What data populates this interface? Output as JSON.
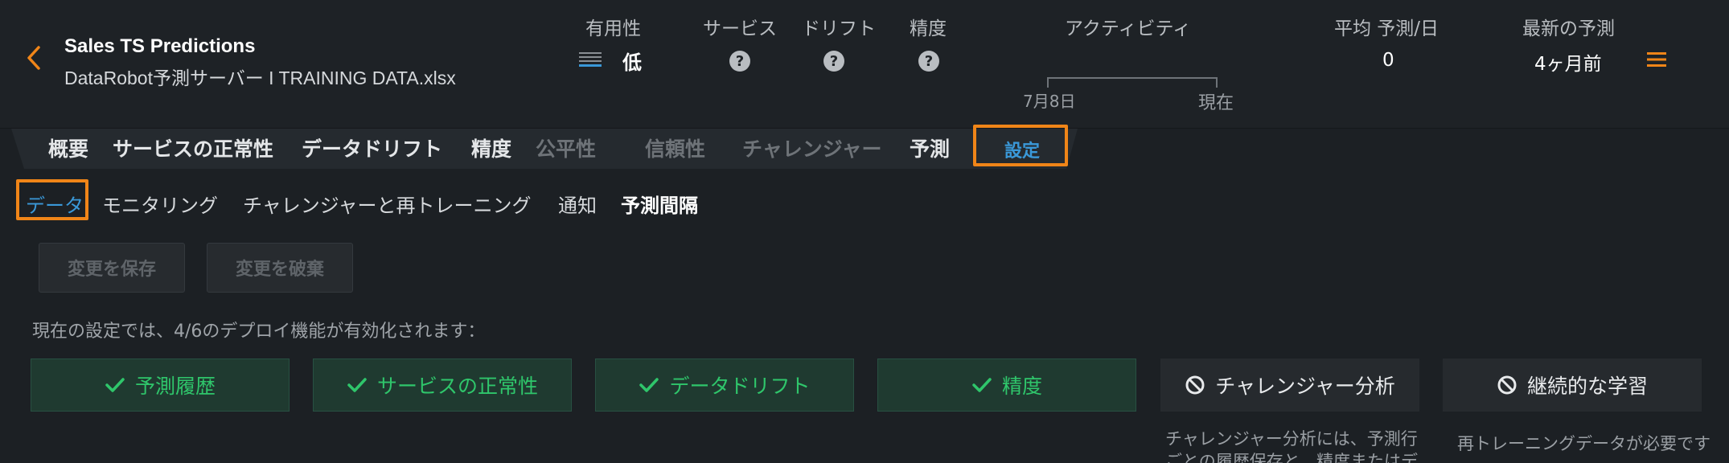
{
  "header": {
    "title": "Sales TS Predictions",
    "subtitle": "DataRobot予測サーバー I TRAINING DATA.xlsx",
    "metrics": {
      "usefulness": {
        "label": "有用性",
        "value": "低"
      },
      "service": {
        "label": "サービス"
      },
      "drift": {
        "label": "ドリフト"
      },
      "accuracy": {
        "label": "精度"
      },
      "activity": {
        "label": "アクティビティ",
        "start": "7月8日",
        "end": "現在"
      },
      "avg_predictions": {
        "label": "平均 予測/日",
        "value": "0"
      },
      "latest_prediction": {
        "label": "最新の予測",
        "value": "4ヶ月前"
      }
    }
  },
  "tabs": [
    {
      "label": "概要"
    },
    {
      "label": "サービスの正常性"
    },
    {
      "label": "データドリフト"
    },
    {
      "label": "精度"
    },
    {
      "label": "公平性"
    },
    {
      "label": "信頼性"
    },
    {
      "label": "チャレンジャー"
    },
    {
      "label": "予測"
    },
    {
      "label": "設定"
    }
  ],
  "subtabs": [
    {
      "label": "データ"
    },
    {
      "label": "モニタリング"
    },
    {
      "label": "チャレンジャーと再トレーニング"
    },
    {
      "label": "通知"
    },
    {
      "label": "予測間隔"
    }
  ],
  "actions": {
    "save": "変更を保存",
    "discard": "変更を破棄"
  },
  "info_text": "現在の設定では、4/6のデプロイ機能が有効化されます：",
  "features": [
    {
      "label": "予測履歴",
      "enabled": true
    },
    {
      "label": "サービスの正常性",
      "enabled": true
    },
    {
      "label": "データドリフト",
      "enabled": true
    },
    {
      "label": "精度",
      "enabled": true
    },
    {
      "label": "チャレンジャー分析",
      "enabled": false
    },
    {
      "label": "継続的な学習",
      "enabled": false
    }
  ],
  "notes": {
    "challenger_line1": "チャレンジャー分析には、予測行",
    "challenger_line2": "ごとの履歴保存と、精度またはデ",
    "retraining": "再トレーニングデータが必要です"
  },
  "colors": {
    "accent": "#f08518",
    "enabled": "#2fc66b",
    "active_tab": "#3a98d8"
  }
}
